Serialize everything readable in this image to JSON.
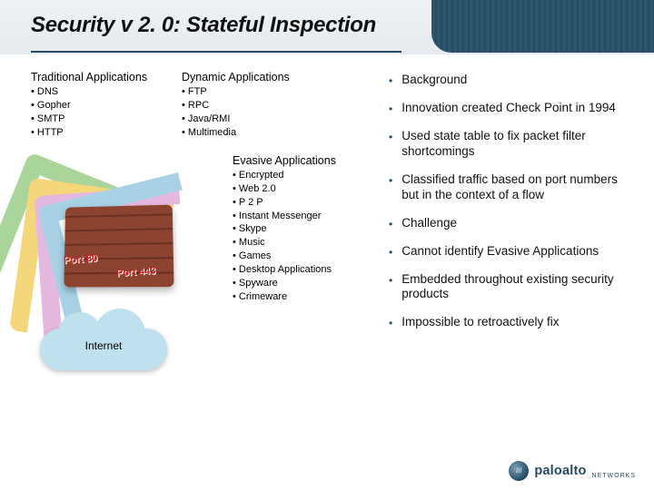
{
  "title": "Security v 2. 0:  Stateful Inspection",
  "traditional": {
    "heading": "Traditional Applications",
    "items": [
      "DNS",
      "Gopher",
      "SMTP",
      "HTTP"
    ]
  },
  "dynamic": {
    "heading": "Dynamic Applications",
    "items": [
      "FTP",
      "RPC",
      "Java/RMI",
      "Multimedia"
    ]
  },
  "evasive": {
    "heading": "Evasive Applications",
    "items": [
      "Encrypted",
      "Web 2.0",
      "P 2 P",
      "Instant Messenger",
      "Skype",
      "Music",
      "Games",
      "Desktop Applications",
      "Spyware",
      "Crimeware"
    ]
  },
  "bullets": [
    "Background",
    "Innovation created Check Point in 1994",
    "Used state table to fix packet filter shortcomings",
    "Classified traffic based on port numbers but in the context of a flow",
    "Challenge",
    "Cannot identify Evasive Applications",
    "Embedded throughout existing security products",
    "Impossible to retroactively fix"
  ],
  "illustration": {
    "port80": "Port 80",
    "port443": "Port 443",
    "cloud_label": "Internet"
  },
  "footer": {
    "brand": "paloalto",
    "sub": "NETWORKS"
  }
}
